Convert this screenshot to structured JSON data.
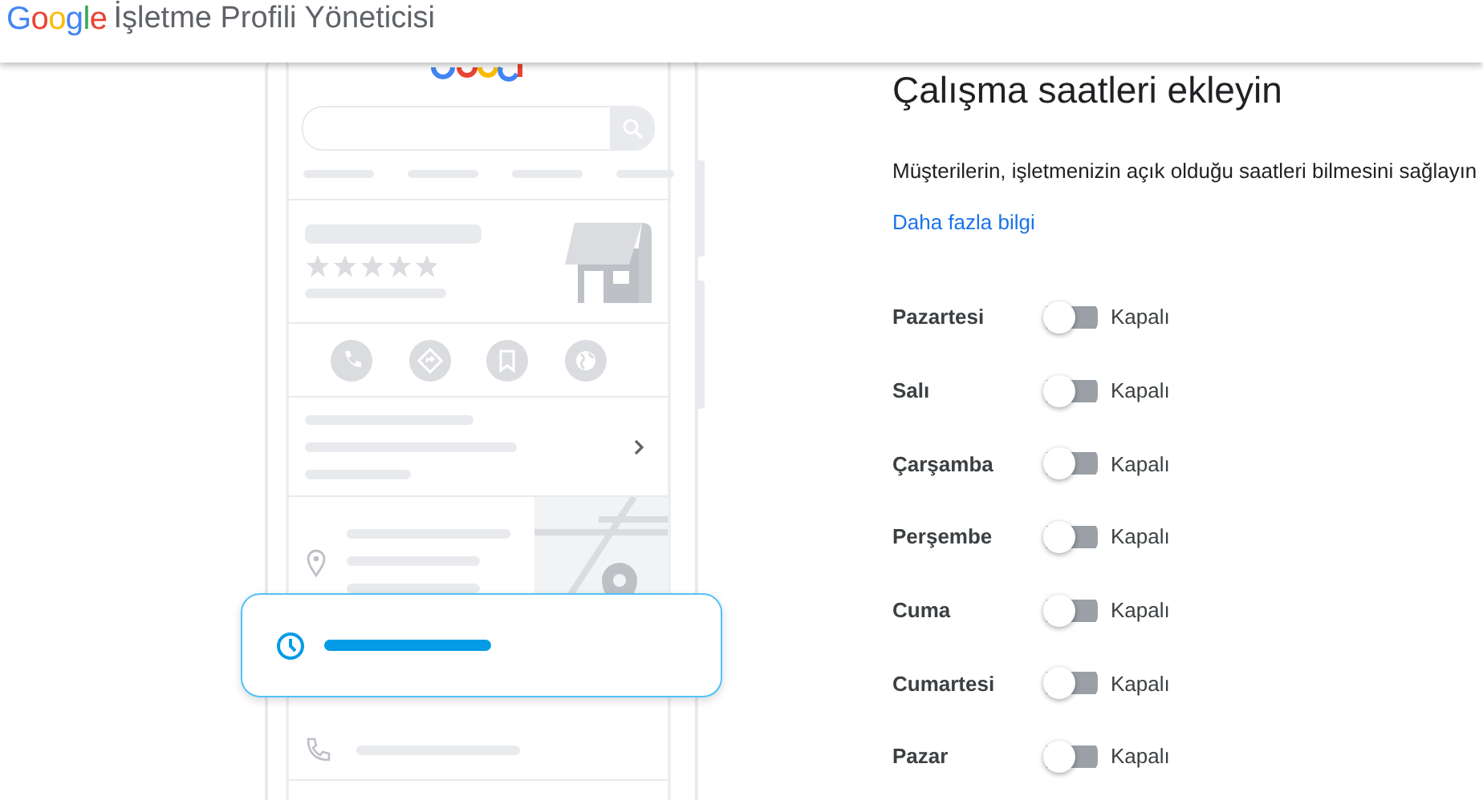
{
  "header": {
    "brand": "Google",
    "product": "İşletme Profili Yöneticisi"
  },
  "panel": {
    "title": "Çalışma saatleri ekleyin",
    "description": "Müşterilerin, işletmenizin açık olduğu saatleri bilmesini sağlayın",
    "link": "Daha fazla bilgi"
  },
  "days": [
    {
      "name": "Pazartesi",
      "on": false,
      "status": "Kapalı"
    },
    {
      "name": "Salı",
      "on": false,
      "status": "Kapalı"
    },
    {
      "name": "Çarşamba",
      "on": false,
      "status": "Kapalı"
    },
    {
      "name": "Perşembe",
      "on": false,
      "status": "Kapalı"
    },
    {
      "name": "Cuma",
      "on": false,
      "status": "Kapalı"
    },
    {
      "name": "Cumartesi",
      "on": false,
      "status": "Kapalı"
    },
    {
      "name": "Pazar",
      "on": false,
      "status": "Kapalı"
    }
  ]
}
